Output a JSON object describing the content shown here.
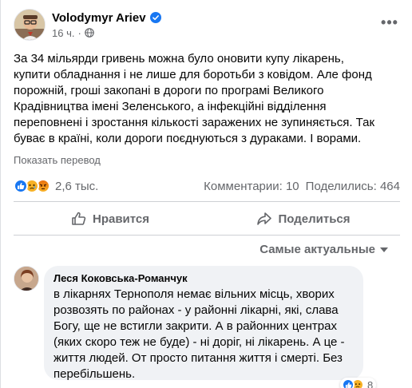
{
  "post": {
    "author": "Volodymyr Ariev",
    "time": "16 ч.",
    "separator": "·",
    "text": "За 34 мільярди гривень можна було оновити купу лікарень,\nкупити обладнання і не лише для боротьби з ковідом. Але фонд\nпорожній, гроші закопані в дороги по програмі Великого\nКрадівництва імені Зеленського, а інфекційні відділення\nпереповнені і зростання кількості заражених не зупиняється. Так\nбуває в країні, коли дороги поєднуються з дураками. І ворами.",
    "see_translation": "Показать перевод",
    "more_glyph": "•••"
  },
  "stats": {
    "reactions_count": "2,6 тыс.",
    "comments": "Комментарии: 10",
    "shares": "Поделились: 464",
    "reaction_icons": [
      "like-icon",
      "sad-icon",
      "angry-icon"
    ]
  },
  "actions": {
    "like_label": "Нравится",
    "share_label": "Поделиться"
  },
  "sort": {
    "label": "Самые актуальные"
  },
  "comment": {
    "author": "Леся Коковська-Романчук",
    "text": "в лікарнях Тернополя немає вільних місць, хворих\nрозвозять по районах - у районні лікарні, які, слава\nБогу, ще не встигли закрити. А в районних центрах\n(яких скоро теж не буде) - ні доріг, ні лікарень. А це -\nжиття людей. От просто питання життя і смерті. Без\nперебільшень.",
    "reactions_count": "8",
    "reaction_icons": [
      "like-icon",
      "sad-icon"
    ]
  },
  "colors": {
    "brand_blue": "#1877f2",
    "secondary_text": "#65676b",
    "bubble_bg": "#f0f2f5"
  }
}
